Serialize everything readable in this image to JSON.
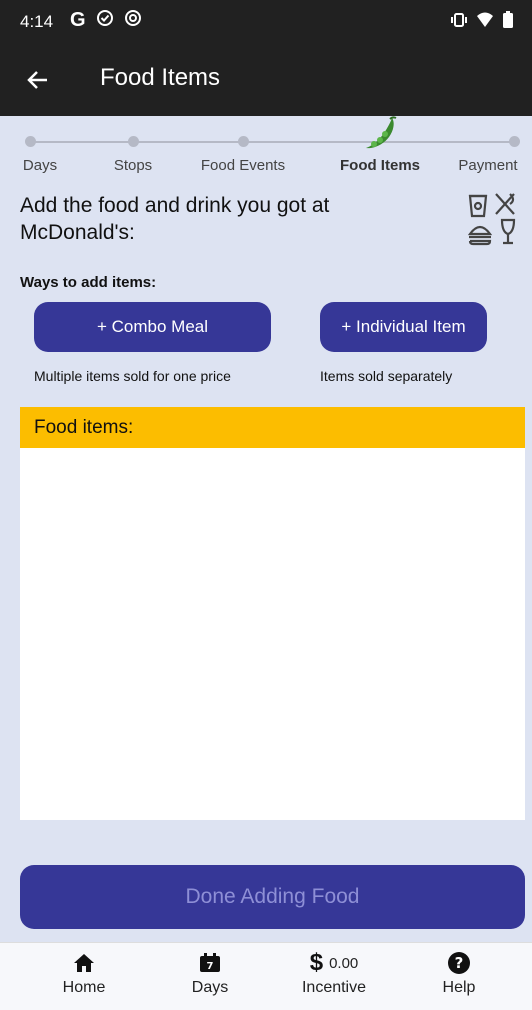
{
  "status_bar": {
    "time": "4:14",
    "left_icons": [
      "google-g-icon",
      "location-check-icon",
      "circle-at-icon"
    ],
    "right_icons": [
      "vibrate-icon",
      "wifi-icon",
      "battery-icon"
    ]
  },
  "app_bar": {
    "title": "Food Items"
  },
  "stepper": {
    "steps": [
      {
        "label": "Days"
      },
      {
        "label": "Stops"
      },
      {
        "label": "Food Events"
      },
      {
        "label": "Food Items"
      },
      {
        "label": "Payment"
      }
    ],
    "active_index": 3
  },
  "prompt": "Add the food and drink you got at McDonald's:",
  "ways_label": "Ways to add items:",
  "buttons": {
    "combo": "+ Combo Meal",
    "combo_hint": "Multiple items sold for one price",
    "individual": "+ Individual Item",
    "individual_hint": "Items sold separately"
  },
  "food_panel": {
    "header": "Food items:",
    "items": []
  },
  "done_button": "Done Adding Food",
  "bottom_nav": {
    "home": "Home",
    "days": "Days",
    "days_icon_number": "7",
    "incentive_amount": "0.00",
    "incentive": "Incentive",
    "help": "Help"
  },
  "colors": {
    "accent": "#363797",
    "header_yellow": "#fcbd00",
    "background": "#dde3f2",
    "bar_dark": "#212121"
  }
}
